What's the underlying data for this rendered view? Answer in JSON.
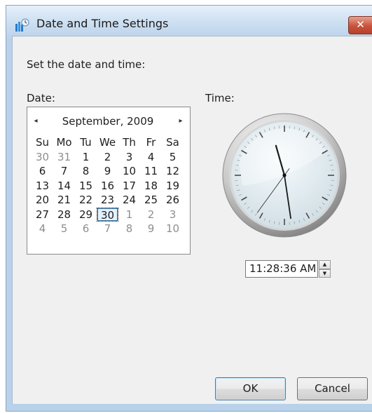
{
  "window": {
    "title": "Date and Time Settings",
    "close_label": "✕",
    "title_icon": "date-time-settings-icon"
  },
  "prompt": "Set the date and time:",
  "date_label": "Date:",
  "time_label": "Time:",
  "calendar": {
    "month_year": "September, 2009",
    "prev_glyph": "◂",
    "next_glyph": "▸",
    "weekdays": [
      "Su",
      "Mo",
      "Tu",
      "We",
      "Th",
      "Fr",
      "Sa"
    ],
    "weeks": [
      [
        "30",
        "31",
        "1",
        "2",
        "3",
        "4",
        "5"
      ],
      [
        "6",
        "7",
        "8",
        "9",
        "10",
        "11",
        "12"
      ],
      [
        "13",
        "14",
        "15",
        "16",
        "17",
        "18",
        "19"
      ],
      [
        "20",
        "21",
        "22",
        "23",
        "24",
        "25",
        "26"
      ],
      [
        "27",
        "28",
        "29",
        "30",
        "1",
        "2",
        "3"
      ],
      [
        "4",
        "5",
        "6",
        "7",
        "8",
        "9",
        "10"
      ]
    ],
    "selected_day": "30"
  },
  "clock": {
    "hour": 11,
    "minute": 28,
    "second": 36
  },
  "time_value": "11:28:36 AM",
  "spinner": {
    "up_glyph": "▲",
    "down_glyph": "▼"
  },
  "buttons": {
    "ok": "OK",
    "cancel": "Cancel"
  },
  "colors": {
    "title_bar": "#c9dcf0",
    "client_bg": "#f0f0f0",
    "close_button": "#c8523c",
    "focus_accent": "#3c7fb1"
  }
}
